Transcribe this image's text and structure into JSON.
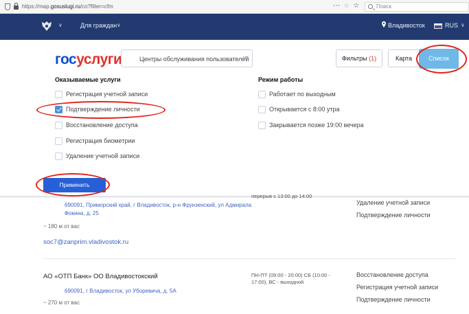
{
  "browser": {
    "url_prefix": "https://map.",
    "url_host": "gosuslugi.ru",
    "url_path": "/co?filter=cfm",
    "search_placeholder": "Поиск",
    "toolbar_glyphs": [
      "⋯",
      "◌",
      "☆"
    ]
  },
  "header": {
    "chevron": "∨",
    "citizens_label": "Для граждан",
    "city": "Владивосток",
    "lang": "RUS",
    "flag_colors": [
      "#ffffff",
      "#1c57a5",
      "#d52b1e"
    ]
  },
  "logo": {
    "part1": "гос",
    "part2": "услуги"
  },
  "search": {
    "value": "Центры обслуживания пользователей",
    "chevron": "∨"
  },
  "buttons": {
    "filters_label": "Фильтры",
    "filters_count": "(1)",
    "map_label": "Карта",
    "list_label": "Список",
    "apply_label": "Применить"
  },
  "filters": {
    "services_title": "Оказываемые услуги",
    "services": [
      {
        "label": "Регистрация учетной записи",
        "checked": false
      },
      {
        "label": "Подтверждение личности",
        "checked": true
      },
      {
        "label": "Восстановление доступа",
        "checked": false
      },
      {
        "label": "Регистрация биометрии",
        "checked": false
      },
      {
        "label": "Удаление учетной записи",
        "checked": false
      }
    ],
    "hours_title": "Режим работы",
    "hours": [
      {
        "label": "Работает по выходным",
        "checked": false
      },
      {
        "label": "Открывается с 8:00 утра",
        "checked": false
      },
      {
        "label": "Закрывается позже 19:00 вечера",
        "checked": false
      }
    ]
  },
  "results": [
    {
      "address_line1": "690091, Приморский край, г Владивосток, р-н Фрунзенский, ул Адмирала",
      "address_line2": "Фокина, д. 25",
      "distance": "~ 180 м от вас",
      "email": "soc7@zanprim.vladivostok.ru",
      "hours_partial": "перерыв с 13:00 до 14:00",
      "services": [
        "Удаление учетной записи",
        "Подтверждение личности"
      ]
    },
    {
      "name": "АО «ОТП Банк» ОО Владивостокский",
      "address_line1": "690091, г Владивосток, ул Уборевича, д. 5А",
      "distance": "~ 270 м от вас",
      "hours_line1": "ПН-ПТ (09:00 - 20:00) СБ (10:00 -",
      "hours_line2": "17:00), ВС - выходной",
      "services": [
        "Восстановление доступа",
        "Регистрация учетной записи",
        "Подтверждение личности"
      ]
    }
  ],
  "colors": {
    "header_bg": "#223a6f",
    "accent_blue": "#0d4cd3",
    "accent_red": "#e2312c",
    "list_button": "#6fb8e8",
    "apply_button": "#2760d6",
    "annotation": "#e2231a"
  }
}
